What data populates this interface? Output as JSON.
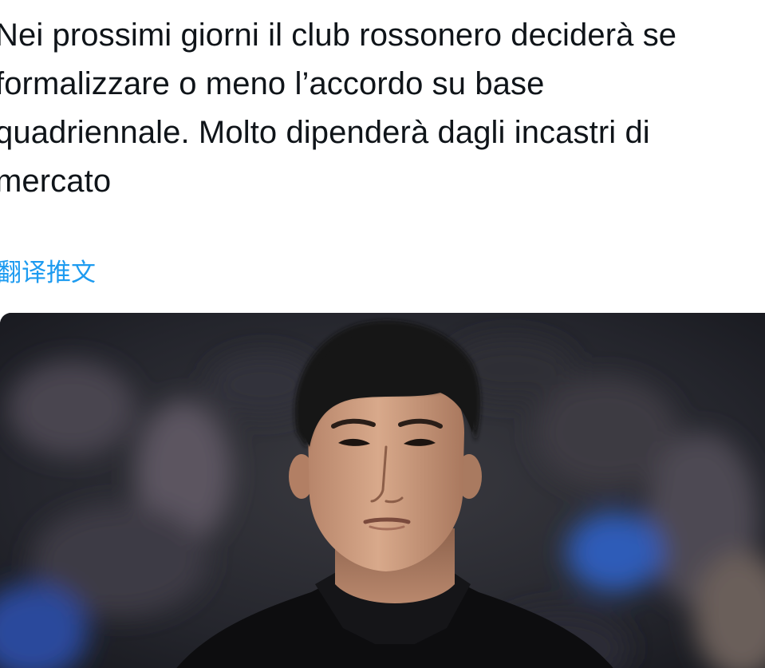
{
  "tweet": {
    "text_lines": [
      "Nei prossimi giorni il club rossonero deciderà se",
      "formalizzare o meno l’accordo su base",
      "quadriennale. Molto dipenderà dagli incastri di",
      "mercato"
    ],
    "translate_label": "翻译推文"
  },
  "media": {
    "icon": "photo-player-portrait",
    "colors": {
      "background_dark": "#15171e",
      "stadium_blue": "#2a4a9c",
      "skin": "#c99a7a",
      "hair": "#141414",
      "jersey": "#0d0d0f"
    }
  }
}
